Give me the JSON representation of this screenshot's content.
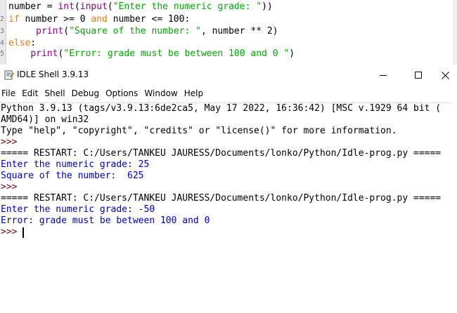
{
  "editor": {
    "lines": [
      {
        "gutter": "",
        "parts": [
          {
            "t": "number = ",
            "c": ""
          },
          {
            "t": "int",
            "c": "bi"
          },
          {
            "t": "(",
            "c": ""
          },
          {
            "t": "input",
            "c": "bi"
          },
          {
            "t": "(",
            "c": ""
          },
          {
            "t": "\"Enter the numeric grade: \"",
            "c": "st"
          },
          {
            "t": "))",
            "c": ""
          }
        ]
      },
      {
        "gutter": "2",
        "parts": [
          {
            "t": "if",
            "c": "kw"
          },
          {
            "t": " number >= 0 ",
            "c": ""
          },
          {
            "t": "and",
            "c": "kw"
          },
          {
            "t": " number <= 100:",
            "c": ""
          }
        ]
      },
      {
        "gutter": "3",
        "parts": [
          {
            "t": "     ",
            "c": ""
          },
          {
            "t": "print",
            "c": "bi"
          },
          {
            "t": "(",
            "c": ""
          },
          {
            "t": "\"Square of the number: \"",
            "c": "st"
          },
          {
            "t": ", number ** 2)",
            "c": ""
          }
        ]
      },
      {
        "gutter": "4",
        "parts": [
          {
            "t": "else",
            "c": "kw"
          },
          {
            "t": ":",
            "c": ""
          }
        ]
      },
      {
        "gutter": "5",
        "parts": [
          {
            "t": "    ",
            "c": ""
          },
          {
            "t": "print",
            "c": "bi"
          },
          {
            "t": "(",
            "c": ""
          },
          {
            "t": "\"Error: grade must be between 100 and 0 \"",
            "c": "st"
          },
          {
            "t": ")",
            "c": ""
          }
        ]
      }
    ]
  },
  "window": {
    "title": "IDLE Shell 3.9.13",
    "minimize_glyph": "—",
    "maximize_glyph": "☐",
    "close_glyph": "✕"
  },
  "menubar": {
    "items": [
      "File",
      "Edit",
      "Shell",
      "Debug",
      "Options",
      "Window",
      "Help"
    ]
  },
  "shell": {
    "lines": [
      {
        "text": "Python 3.9.13 (tags/v3.9.13:6de2ca5, May 17 2022, 16:36:42) [MSC v.1929 64 bit (",
        "color": "black"
      },
      {
        "text": "AMD64)] on win32",
        "color": "black"
      },
      {
        "text": "Type \"help\", \"copyright\", \"credits\" or \"license()\" for more information.",
        "color": "black"
      },
      {
        "text": ">>> ",
        "color": "maroon"
      },
      {
        "text": "===== RESTART: C:/Users/TANKEU JAURESS/Documents/lonko/Python/Idle-prog.py =====",
        "color": "black"
      },
      {
        "text": "Enter the numeric grade: 25",
        "color": "blue"
      },
      {
        "text": "Square of the number:  625",
        "color": "blue"
      },
      {
        "text": ">>> ",
        "color": "maroon"
      },
      {
        "text": "===== RESTART: C:/Users/TANKEU JAURESS/Documents/lonko/Python/Idle-prog.py =====",
        "color": "black"
      },
      {
        "text": "Enter the numeric grade: -50",
        "color": "blue"
      },
      {
        "text": "Error: grade must be between 100 and 0",
        "color": "blue"
      },
      {
        "text": ">>> ",
        "color": "maroon"
      }
    ],
    "colors": {
      "black": "#000000",
      "blue": "#0000cc",
      "maroon": "#770000"
    }
  }
}
